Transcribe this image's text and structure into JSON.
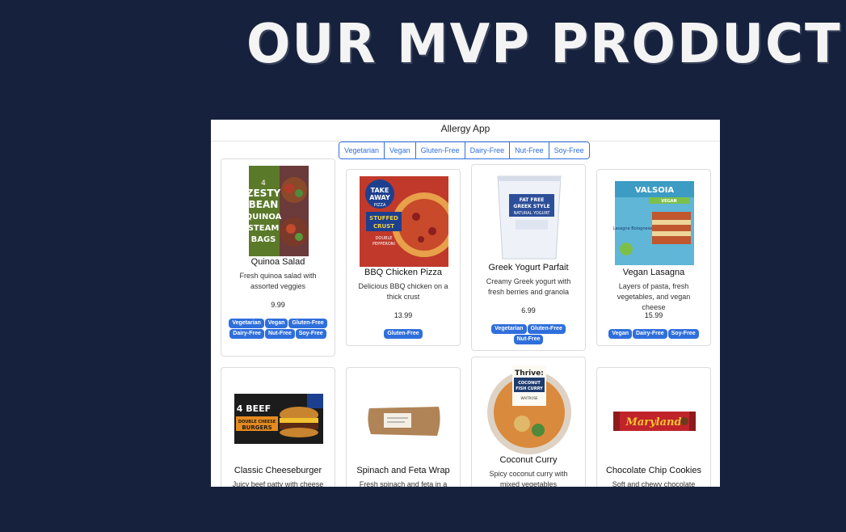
{
  "slide": {
    "title": "OUR MVP PRODUCT"
  },
  "app": {
    "title": "Allergy App"
  },
  "filters": [
    "Vegetarian",
    "Vegan",
    "Gluten-Free",
    "Dairy-Free",
    "Nut-Free",
    "Soy-Free"
  ],
  "products": [
    {
      "name": "Quinoa Salad",
      "description": "Fresh quinoa salad with assorted veggies",
      "price": "9.99",
      "tags": [
        "Vegetarian",
        "Vegan",
        "Gluten-Free",
        "Dairy-Free",
        "Nut-Free",
        "Soy-Free"
      ],
      "package_text": [
        "4",
        "ZESTY",
        "BEAN",
        "QUINOA",
        "STEAM",
        "BAGS"
      ]
    },
    {
      "name": "BBQ Chicken Pizza",
      "description": "Delicious BBQ chicken on a thick crust",
      "price": "13.99",
      "tags": [
        "Gluten-Free"
      ],
      "package_text": [
        "TAKE",
        "AWAY",
        "PIZZA",
        "STUFFED",
        "CRUST",
        "DOUBLE",
        "PEPPERONI"
      ]
    },
    {
      "name": "Greek Yogurt Parfait",
      "description": "Creamy Greek yogurt with fresh berries and granola",
      "price": "6.99",
      "tags": [
        "Vegetarian",
        "Gluten-Free",
        "Nut-Free"
      ],
      "package_text": [
        "FAT FREE",
        "GREEK STYLE",
        "NATURAL YOGURT"
      ]
    },
    {
      "name": "Vegan Lasagna",
      "description": "Layers of pasta, fresh vegetables, and vegan cheese",
      "price": "15.99",
      "tags": [
        "Vegan",
        "Dairy-Free",
        "Soy-Free"
      ],
      "package_text": [
        "VALSOIA",
        "VEGAN",
        "Lasagne Bolognese"
      ]
    },
    {
      "name": "Classic Cheeseburger",
      "description": "Juicy beef patty with cheese",
      "price": "",
      "tags": [],
      "package_text": [
        "4 BEEF",
        "DOUBLE CHEESE",
        "BURGERS"
      ]
    },
    {
      "name": "Spinach and Feta Wrap",
      "description": "Fresh spinach and feta in a",
      "price": "",
      "tags": [],
      "package_text": []
    },
    {
      "name": "Coconut Curry",
      "description": "Spicy coconut curry with mixed vegetables",
      "price": "",
      "tags": [],
      "package_text": [
        "Thrive:",
        "COCONUT",
        "FISH CURRY",
        "WAITROSE"
      ]
    },
    {
      "name": "Chocolate Chip Cookies",
      "description": "Soft and chewy chocolate",
      "price": "",
      "tags": [],
      "package_text": [
        "Maryland"
      ]
    }
  ],
  "colors": {
    "background": "#16213d",
    "accent": "#2f6fdc"
  }
}
